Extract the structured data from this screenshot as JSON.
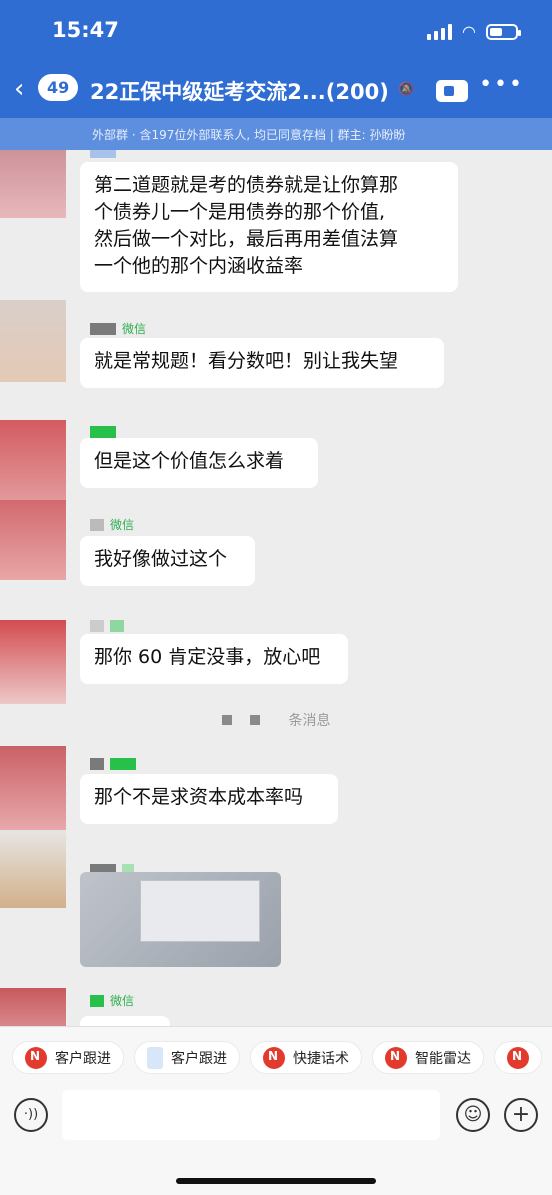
{
  "status_bar": {
    "time": "15:47"
  },
  "nav": {
    "back_icon": "‹",
    "unread_count": "49",
    "title": "22正保中级延考交流2...(200)",
    "mute_icon": "mute-icon",
    "more_icon": "•••"
  },
  "subtitle": "外部群 · 含197位外部联系人, 均已同意存档 | 群主: 孙盼盼",
  "messages": [
    {
      "sender_tag": "",
      "text": "第二道题就是考的债券就是让你算那\n个债券儿一个是用债券的那个价值,\n然后做一个对比，最后再用差值法算\n一个他的那个内涵收益率"
    },
    {
      "sender_tag": "微信",
      "text": "就是常规题！看分数吧！别让我失望"
    },
    {
      "sender_tag": "",
      "text": "但是这个价值怎么求着"
    },
    {
      "sender_tag": "微信",
      "text": "我好像做过这个"
    },
    {
      "sender_tag": "",
      "text": "那你 60 肯定没事，放心吧"
    },
    {
      "sender_tag": "",
      "text": "那个不是求资本成本率吗"
    },
    {
      "sender_tag": "微信",
      "text": ""
    }
  ],
  "system_message": "条消息",
  "quickbar": [
    {
      "label": "客户跟进",
      "icon": "app-logo-icon"
    },
    {
      "label": "客户跟进",
      "icon": "document-icon"
    },
    {
      "label": "快捷话术",
      "icon": "app-logo-icon"
    },
    {
      "label": "智能雷达",
      "icon": "app-logo-icon"
    }
  ],
  "input": {
    "placeholder": ""
  },
  "colors": {
    "header": "#2F6DD3",
    "accent_green": "#2EAD4F",
    "logo_red": "#E23B2E"
  }
}
